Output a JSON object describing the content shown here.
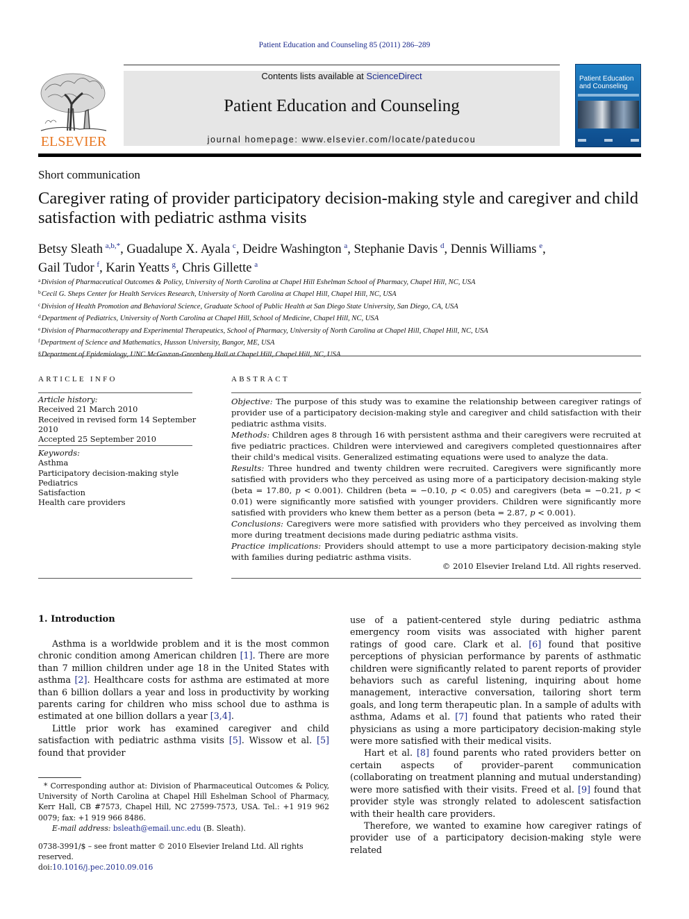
{
  "running_head": "Patient Education and Counseling 85 (2011) 286–289",
  "masthead": {
    "contents_prefix": "Contents lists available at ",
    "contents_link": "ScienceDirect",
    "journal_title": "Patient Education and Counseling",
    "homepage": "journal homepage: www.elsevier.com/locate/pateducou",
    "publisher_logo_text": "ELSEVIER",
    "cover_title_line1": "Patient Education",
    "cover_title_line2": "and Counseling",
    "colors": {
      "publisher_orange": "#e87722",
      "link_blue": "#1b2a8c",
      "cover_blue": "#1663a6",
      "masthead_gray": "#e6e6e6"
    }
  },
  "article": {
    "type": "Short communication",
    "title": "Caregiver rating of provider participatory decision-making style and caregiver and child satisfaction with pediatric asthma visits",
    "authors": [
      {
        "name": "Betsy Sleath",
        "aff": "a,b,*",
        "sep": ", "
      },
      {
        "name": "Guadalupe X. Ayala",
        "aff": "c",
        "sep": ", "
      },
      {
        "name": "Deidre Washington",
        "aff": "a",
        "sep": ", "
      },
      {
        "name": "Stephanie Davis",
        "aff": "d",
        "sep": ", "
      },
      {
        "name": "Dennis Williams",
        "aff": "e",
        "sep": ", "
      },
      {
        "name": "Gail Tudor",
        "aff": "f",
        "sep": ", "
      },
      {
        "name": "Karin Yeatts",
        "aff": "g",
        "sep": ", "
      },
      {
        "name": "Chris Gillette",
        "aff": "a",
        "sep": ""
      }
    ],
    "affiliations": [
      {
        "key": "a",
        "text": "Division of Pharmaceutical Outcomes & Policy, University of North Carolina at Chapel Hill Eshelman School of Pharmacy, Chapel Hill, NC, USA"
      },
      {
        "key": "b",
        "text": "Cecil G. Sheps Center for Health Services Research, University of North Carolina at Chapel Hill, Chapel Hill, NC, USA"
      },
      {
        "key": "c",
        "text": "Division of Health Promotion and Behavioral Science, Graduate School of Public Health at San Diego State University, San Diego, CA, USA"
      },
      {
        "key": "d",
        "text": "Department of Pediatrics, University of North Carolina at Chapel Hill, School of Medicine, Chapel Hill, NC, USA"
      },
      {
        "key": "e",
        "text": "Division of Pharmacotherapy and Experimental Therapeutics, School of Pharmacy, University of North Carolina at Chapel Hill, Chapel Hill, NC, USA"
      },
      {
        "key": "f",
        "text": "Department of Science and Mathematics, Husson University, Bangor, ME, USA"
      },
      {
        "key": "g",
        "text": "Department of Epidemiology, UNC McGavran-Greenberg Hall at Chapel Hill, Chapel Hill, NC, USA"
      }
    ]
  },
  "article_info": {
    "heading": "ARTICLE INFO",
    "history_label": "Article history:",
    "history": [
      "Received 21 March 2010",
      "Received in revised form 14 September 2010",
      "Accepted 25 September 2010"
    ],
    "keywords_label": "Keywords:",
    "keywords": [
      "Asthma",
      "Participatory decision-making style",
      "Pediatrics",
      "Satisfaction",
      "Health care providers"
    ]
  },
  "abstract": {
    "heading": "ABSTRACT",
    "sections": [
      {
        "label": "Objective:",
        "text": " The purpose of this study was to examine the relationship between caregiver ratings of provider use of a participatory decision-making style and caregiver and child satisfaction with their pediatric asthma visits."
      },
      {
        "label": "Methods:",
        "text": "  Children ages 8 through 16 with persistent asthma and their caregivers were recruited at five pediatric practices. Children were interviewed and caregivers completed questionnaires after their child's medical visits. Generalized estimating equations were used to analyze the data."
      },
      {
        "label": "Results:",
        "text": "  Three hundred and twenty children were recruited. Caregivers were significantly more satisfied with providers who they perceived as using more of a participatory decision-making style (beta = 17.80, p < 0.001). Children (beta = −0.10, p < 0.05) and caregivers (beta = −0.21, p < 0.01) were significantly more satisfied with younger providers. Children were significantly more satisfied with providers who knew them better as a person (beta = 2.87, p < 0.001)."
      },
      {
        "label": "Conclusions:",
        "text": "  Caregivers were more satisfied with providers who they perceived as involving them more during treatment decisions made during pediatric asthma visits."
      },
      {
        "label": "Practice implications:",
        "text": "  Providers should attempt to use a more participatory decision-making style with families during pediatric asthma visits."
      }
    ],
    "copyright": "© 2010 Elsevier Ireland Ltd. All rights reserved."
  },
  "body": {
    "intro_heading": "1.  Introduction",
    "left_paragraphs": [
      [
        {
          "t": "Asthma is a worldwide problem and it is the most common chronic condition among American children "
        },
        {
          "ref": "[1]"
        },
        {
          "t": ". There are more than 7 million children under age 18 in the United States with asthma "
        },
        {
          "ref": "[2]"
        },
        {
          "t": ". Healthcare costs for asthma are estimated at more than 6 billion dollars a year and loss in productivity by working parents caring for children who miss school due to asthma is estimated at one billion dollars a year "
        },
        {
          "ref": "[3,4]"
        },
        {
          "t": "."
        }
      ],
      [
        {
          "t": "Little prior work has examined caregiver and child satisfaction with pediatric asthma visits "
        },
        {
          "ref": "[5]"
        },
        {
          "t": ". Wissow et al. "
        },
        {
          "ref": "[5]"
        },
        {
          "t": " found that provider"
        }
      ]
    ],
    "right_paragraphs": [
      [
        {
          "t": "use of a patient-centered style during pediatric asthma emergency room visits was associated with higher parent ratings of good care. Clark et al. "
        },
        {
          "ref": "[6]"
        },
        {
          "t": " found that positive perceptions of physician performance by parents of asthmatic children were significantly related to parent reports of provider behaviors such as careful listening, inquiring about home management, interactive conversation, tailoring short term goals, and long term therapeutic plan. In a sample of adults with asthma, Adams et al. "
        },
        {
          "ref": "[7]"
        },
        {
          "t": " found that patients who rated their physicians as using a more participatory decision-making style were more satisfied with their medical visits."
        }
      ],
      [
        {
          "t": "Hart et al. "
        },
        {
          "ref": "[8]"
        },
        {
          "t": " found parents who rated providers better on certain aspects of provider–parent communication (collaborating on treatment planning and mutual understanding) were more satisfied with their visits. Freed et al. "
        },
        {
          "ref": "[9]"
        },
        {
          "t": " found that provider style was strongly related to adolescent satisfaction with their health care providers."
        }
      ],
      [
        {
          "t": "Therefore, we wanted to examine how caregiver ratings of provider use of a participatory decision-making style were related"
        }
      ]
    ]
  },
  "footnote": {
    "corresponding": "* Corresponding author at: Division of Pharmaceutical Outcomes & Policy, University of North Carolina at Chapel Hill Eshelman School of Pharmacy, Kerr Hall, CB #7573, Chapel Hill, NC 27599-7573, USA. Tel.: +1 919 962 0079; fax: +1 919 966 8486.",
    "email_label": "E-mail address:",
    "email": "bsleath@email.unc.edu",
    "email_suffix": " (B. Sleath).",
    "issn_line": "0738-3991/$ – see front matter © 2010 Elsevier Ireland Ltd. All rights reserved.",
    "doi_prefix": "doi:",
    "doi": "10.1016/j.pec.2010.09.016"
  }
}
